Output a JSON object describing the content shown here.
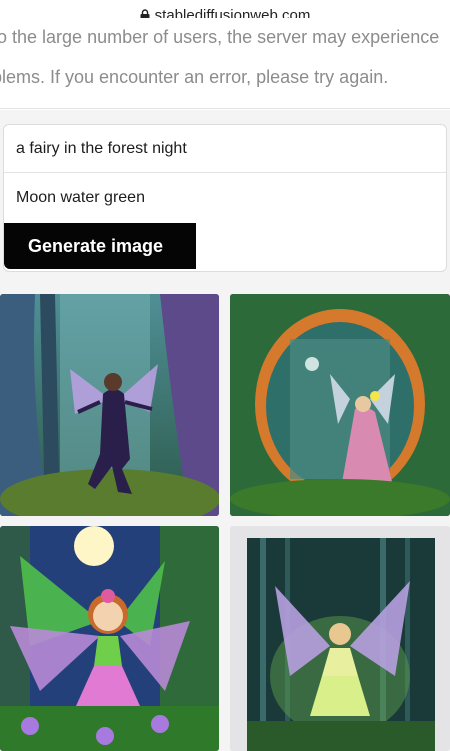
{
  "browser": {
    "url": "stablediffusionweb.com",
    "lock_icon": "lock-icon"
  },
  "notice": {
    "line1": "to the large number of users, the server may experience",
    "line2": "blems. If you encounter an error, please try again."
  },
  "form": {
    "prompt_value": "a fairy in the forest night",
    "second_value": "Moon water green",
    "generate_label": "Generate image"
  },
  "colors": {
    "page_bg": "#f4f4f5",
    "button_bg": "#050505",
    "button_text": "#ffffff",
    "notice_text": "#8c8c8c"
  },
  "results": {
    "images": [
      "fairy-image-1",
      "fairy-image-2",
      "fairy-image-3",
      "fairy-image-4"
    ]
  }
}
